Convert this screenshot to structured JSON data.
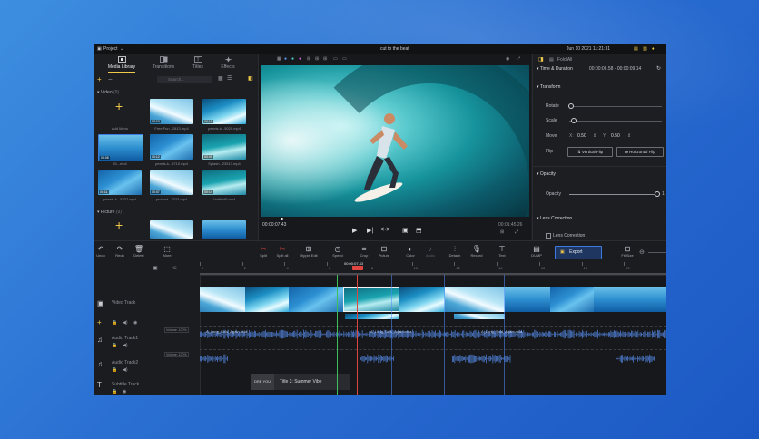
{
  "window": {
    "project_menu": "Project",
    "title": "cut to the beat",
    "datetime": "Jun 10 2021 11:21:31"
  },
  "left_panel": {
    "tabs": [
      {
        "label": "Media Library"
      },
      {
        "label": "Transitions"
      },
      {
        "label": "Titles"
      },
      {
        "label": "Effects"
      }
    ],
    "search_placeholder": "Search...",
    "video_section": {
      "label": "Video",
      "count": "(9)"
    },
    "picture_section": {
      "label": "Picture",
      "count": "(9)"
    },
    "add_menu_label": "Add Menu",
    "clips": [
      {
        "name": "Free Fun...2813.mp4",
        "duration": "00:10"
      },
      {
        "name": "pexels-k...5020.mp4",
        "duration": "00:15"
      },
      {
        "name": "53...mp4",
        "duration": "00:08"
      },
      {
        "name": "pexels-k...5710.mp4",
        "duration": "00:12"
      },
      {
        "name": "Splash...23513.mp4",
        "duration": "00:09"
      },
      {
        "name": "pexels-k...5707.mp4",
        "duration": "00:11"
      },
      {
        "name": "product...7023.mp4",
        "duration": "00:07"
      },
      {
        "name": "Untitled5.mp4",
        "duration": "00:14"
      }
    ]
  },
  "preview": {
    "current_time": "00:00:07.43",
    "total_time": "00:01:45.26"
  },
  "right_panel": {
    "fold_all": "Fold All",
    "time_duration_label": "Time & Duration",
    "time_duration_value": "00:00:06.58 - 00:00:09.14",
    "transform_label": "Transform",
    "rotate_label": "Rotate",
    "scale_label": "Scale",
    "move_label": "Move",
    "move_x_label": "X:",
    "move_x": "0.50",
    "move_y_label": "Y:",
    "move_y": "0.50",
    "flip_label": "Flip",
    "vertical_flip": "Vertical Flip",
    "horizontal_flip": "Horizontal Flip",
    "opacity_section": "Opacity",
    "opacity_label": "Opacity",
    "opacity_value": "1",
    "lens_correction_section": "Lens Correction",
    "lens_correction_checkbox": "Lens Correction"
  },
  "toolbar": {
    "undo": "Undo",
    "redo": "Redo",
    "delete": "Delete",
    "more": "More",
    "split": "Split",
    "split_all": "Split all",
    "ripple_edit": "Ripple Edit",
    "speed": "Speed",
    "crop": "Crop",
    "picture": "Picture",
    "color": "Color",
    "audio": "Audio",
    "detach": "Detach",
    "record": "Record",
    "text": "Text",
    "dump": "DUMP",
    "export": "Export",
    "fit_size": "Fit Size"
  },
  "timeline": {
    "playhead_time": "00:00:07.43",
    "ruler_marks": [
      "0",
      "2",
      "4",
      "6",
      "8",
      "10",
      "12",
      "14",
      "16",
      "18",
      "20"
    ],
    "tracks": {
      "video": "Video Track",
      "audio1": "Audio Track1",
      "audio2": "Audio Track2",
      "subtitle": "Subtitle Track"
    },
    "volume_badge": "Volume: 100%",
    "audio_clip_label": "A_Long_Sold_Again.m4a",
    "title_clip_prefix": "DRE YOU",
    "title_clip_label": "Title 3: Summer Vibe"
  },
  "colors": {
    "accent": "#f0c94a",
    "export_border": "#3d7be0",
    "audio_wave": "#4a78c8",
    "playhead": "#e0463f"
  }
}
